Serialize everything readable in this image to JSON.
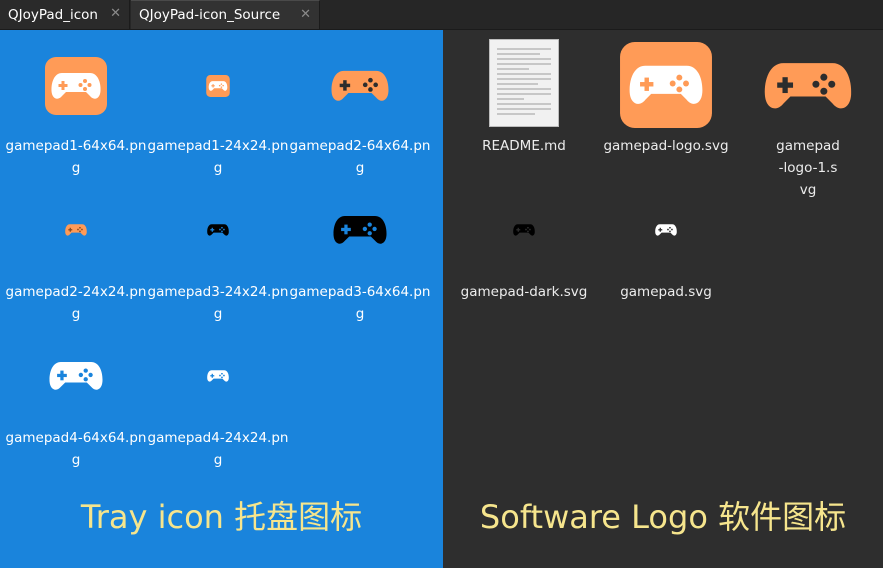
{
  "tabs": [
    {
      "label": "QJoyPad_icon",
      "close_icon": "close-icon"
    },
    {
      "label": "QJoyPad-icon_Source",
      "close_icon": "close-icon"
    }
  ],
  "left_pane": {
    "background": "#1a84dc",
    "files": [
      {
        "name": "gamepad1-64x64.png",
        "icon": "gamepad-icon-orange-tile"
      },
      {
        "name": "gamepad1-24x24.png",
        "icon": "gamepad-icon-orange-tile-small"
      },
      {
        "name": "gamepad2-64x64.png",
        "icon": "gamepad-icon-orange"
      },
      {
        "name": "gamepad2-24x24.png",
        "icon": "gamepad-icon-orange-small"
      },
      {
        "name": "gamepad3-24x24.png",
        "icon": "gamepad-icon-black-small"
      },
      {
        "name": "gamepad3-64x64.png",
        "icon": "gamepad-icon-black"
      },
      {
        "name": "gamepad4-64x64.png",
        "icon": "gamepad-icon-white"
      },
      {
        "name": "gamepad4-24x24.png",
        "icon": "gamepad-icon-white-small"
      }
    ],
    "caption": "Tray icon 托盘图标"
  },
  "right_pane": {
    "background": "#2e2e2e",
    "files": [
      {
        "name": "README.md",
        "icon": "text-document-icon"
      },
      {
        "name": "gamepad-logo.svg",
        "icon": "gamepad-icon-orange-tile"
      },
      {
        "name": "gamepad-logo-1.svg",
        "icon": "gamepad-icon-orange"
      },
      {
        "name": "gamepad-dark.svg",
        "icon": "gamepad-icon-black-small"
      },
      {
        "name": "gamepad.svg",
        "icon": "gamepad-icon-white-small"
      }
    ],
    "caption": "Software Logo 软件图标"
  },
  "colors": {
    "orange": "#ff9b57",
    "black": "#000000",
    "white": "#ffffff",
    "caption": "#f6e58d"
  }
}
